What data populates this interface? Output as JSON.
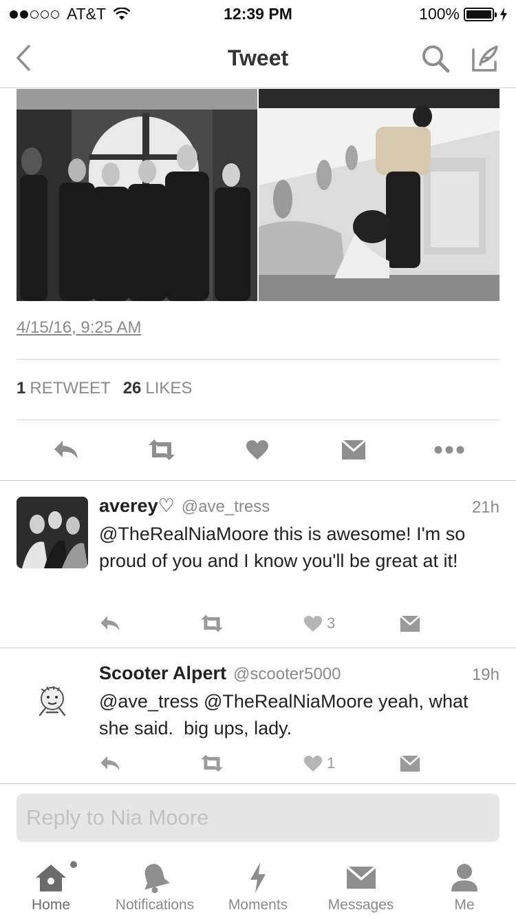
{
  "status_bar": {
    "carrier": "AT&T",
    "time": "12:39 PM",
    "battery": "100%",
    "signal_bars_filled": 2,
    "signal_bars_total": 5
  },
  "nav": {
    "title": "Tweet",
    "back_icon": "chevron-left-icon",
    "search_icon": "search-icon",
    "compose_icon": "compose-icon"
  },
  "tweet": {
    "timestamp": "4/15/16, 9:25 AM",
    "retweets_count": "1",
    "retweets_label": "RETWEET",
    "likes_count": "26",
    "likes_label": "LIKES"
  },
  "replies": [
    {
      "name": "averey♡",
      "handle": "@ave_tress",
      "time": "21h",
      "text": "@TheRealNiaMoore this is awesome! I'm so proud of you and I know you'll be great at it!",
      "likes": "3"
    },
    {
      "name": "Scooter Alpert",
      "handle": "@scooter5000",
      "time": "19h",
      "text": "@ave_tress @TheRealNiaMoore yeah, what she said.  big ups, lady.",
      "likes": "1"
    }
  ],
  "reply_box": {
    "placeholder": "Reply to Nia Moore"
  },
  "tabs": [
    {
      "label": "Home",
      "icon": "home-icon",
      "active": true
    },
    {
      "label": "Notifications",
      "icon": "bell-icon",
      "active": false
    },
    {
      "label": "Moments",
      "icon": "lightning-icon",
      "active": false
    },
    {
      "label": "Messages",
      "icon": "envelope-icon",
      "active": false
    },
    {
      "label": "Me",
      "icon": "person-icon",
      "active": false
    }
  ],
  "colors": {
    "icon_gray": "#8e8e8e",
    "text_dark": "#222222",
    "text_muted": "#8a8a8a"
  }
}
